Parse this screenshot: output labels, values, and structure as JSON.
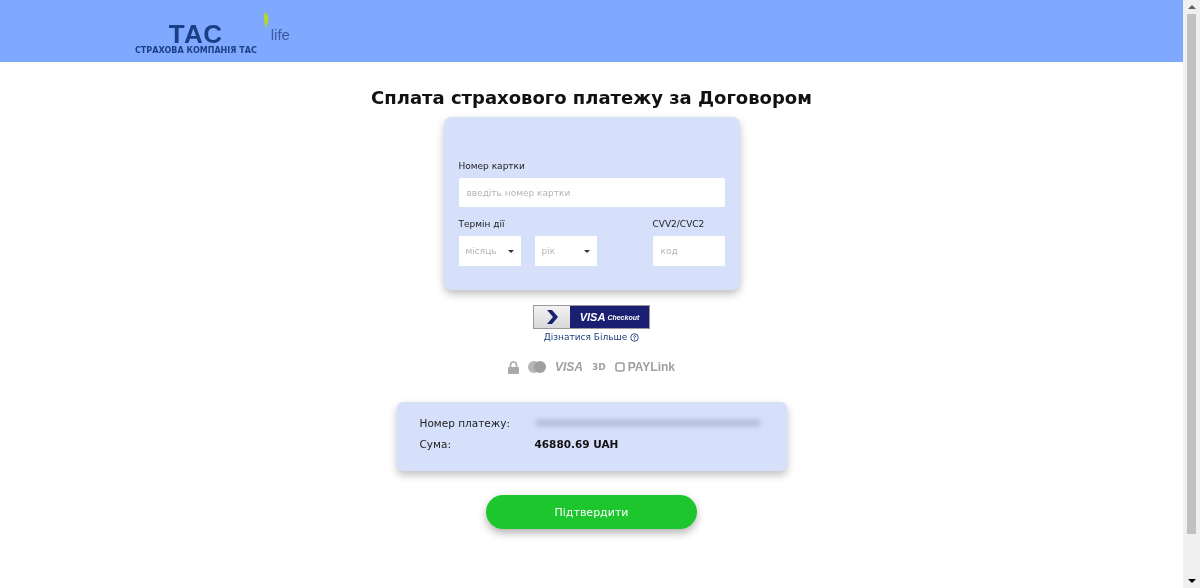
{
  "header": {
    "logo": {
      "brand": "ТАС",
      "suffix": "life",
      "tagline": "СТРАХОВА КОМПАНІЯ ТАС"
    }
  },
  "title": "Сплата страхового платежу за Договором",
  "card_form": {
    "card_number": {
      "label": "Номер картки",
      "placeholder": "введіть номер картки"
    },
    "expiry": {
      "label": "Термін дії",
      "month": {
        "placeholder": "місяць"
      },
      "year": {
        "placeholder": "рік"
      }
    },
    "cvv": {
      "label": "CVV2/CVC2",
      "placeholder": "код"
    }
  },
  "visa_checkout": {
    "brand": "VISA",
    "text": "Checkout",
    "learn_more": "Дізнатися Більше"
  },
  "security_badges": [
    {
      "kind": "lock"
    },
    {
      "kind": "mastercard"
    },
    {
      "kind": "text",
      "label": "VISA"
    },
    {
      "kind": "secure",
      "label": "3D"
    },
    {
      "kind": "paylink",
      "label": "PAYLink"
    }
  ],
  "payment": {
    "rows": [
      {
        "label": "Номер платежу:",
        "kind": "blurred"
      },
      {
        "label": "Сума:",
        "kind": "text",
        "value": "46880.69 UAH"
      }
    ]
  },
  "confirm_button": "Підтвердити"
}
